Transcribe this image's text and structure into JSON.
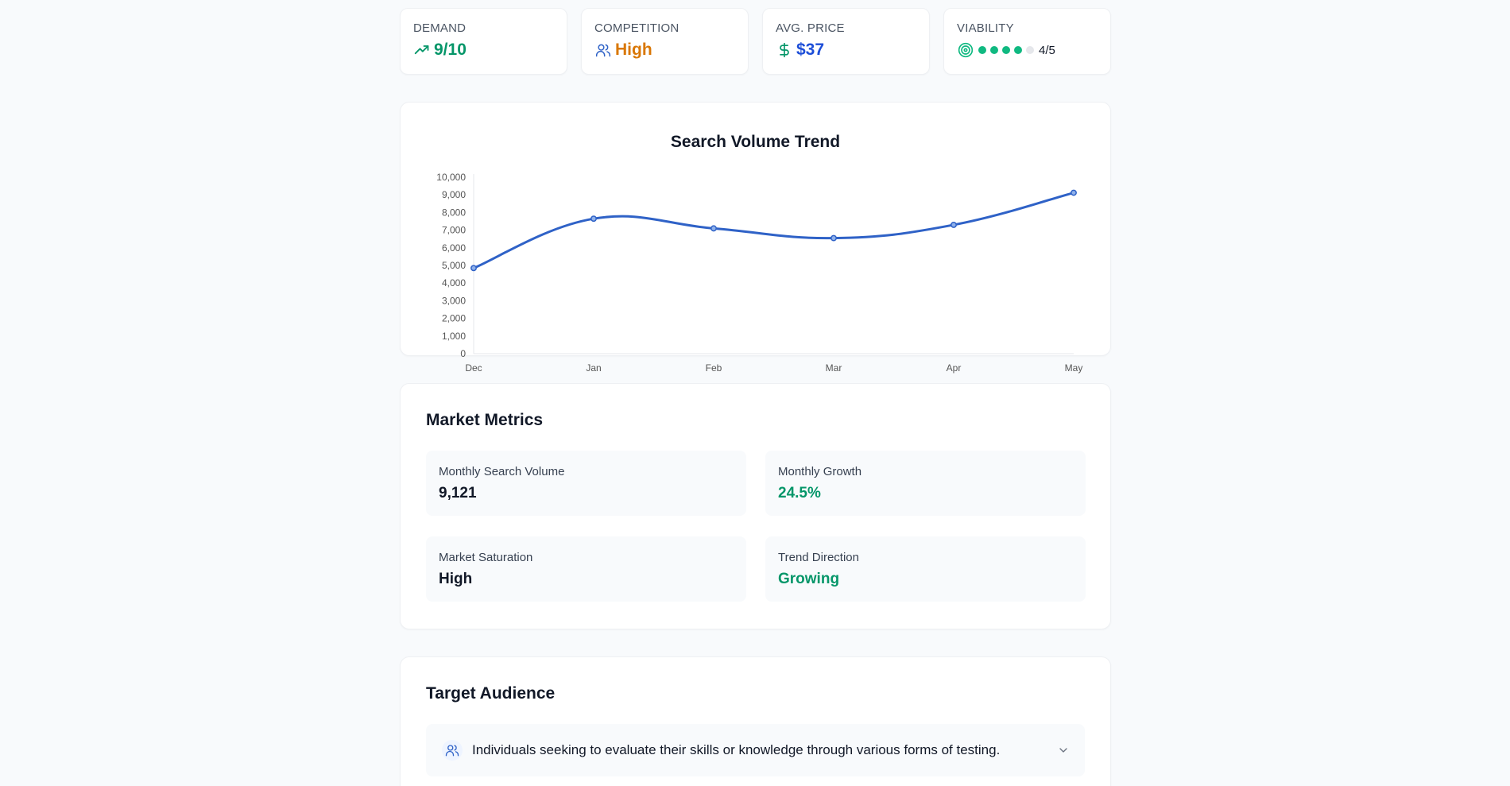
{
  "stats": {
    "demand": {
      "label": "DEMAND",
      "value": "9/10",
      "icon": "trending-up-icon",
      "color": "#059669"
    },
    "competition": {
      "label": "COMPETITION",
      "value": "High",
      "icon": "users-icon",
      "color": "#d97706"
    },
    "avg_price": {
      "label": "AVG. PRICE",
      "value": "$37",
      "icon": "dollar-icon",
      "color": "#1d4ed8"
    },
    "viability": {
      "label": "VIABILITY",
      "rating": 4,
      "max": 5,
      "text": "4/5",
      "icon": "target-icon",
      "color": "#10b981"
    }
  },
  "chart_data": {
    "type": "line",
    "title": "Search Volume Trend",
    "categories": [
      "Dec",
      "Jan",
      "Feb",
      "Mar",
      "Apr",
      "May"
    ],
    "series": [
      {
        "values": [
          4850,
          7650,
          7100,
          6550,
          7300,
          9121
        ],
        "color": "#2f62c7"
      }
    ],
    "ylim": [
      0,
      10000
    ],
    "yticks": [
      "0",
      "1,000",
      "2,000",
      "3,000",
      "4,000",
      "5,000",
      "6,000",
      "7,000",
      "8,000",
      "9,000",
      "10,000"
    ],
    "grid": false,
    "legend": "none"
  },
  "metrics": {
    "title": "Market Metrics",
    "items": [
      {
        "label": "Monthly Search Volume",
        "value": "9,121",
        "color": "#111827"
      },
      {
        "label": "Monthly Growth",
        "value": "24.5%",
        "color": "#059669"
      },
      {
        "label": "Market Saturation",
        "value": "High",
        "color": "#111827"
      },
      {
        "label": "Trend Direction",
        "value": "Growing",
        "color": "#059669"
      }
    ]
  },
  "audience": {
    "title": "Target Audience",
    "items": [
      {
        "text": "Individuals seeking to evaluate their skills or knowledge through various forms of testing.",
        "icon": "users-icon",
        "expand_icon": "chevron-down-icon"
      }
    ]
  }
}
